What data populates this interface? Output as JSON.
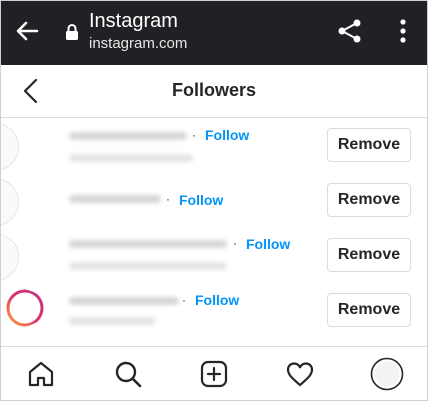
{
  "browser": {
    "site_title": "Instagram",
    "url": "instagram.com"
  },
  "header": {
    "title": "Followers"
  },
  "followers": [
    {
      "follow_label": "Follow",
      "remove_label": "Remove"
    },
    {
      "follow_label": "Follow",
      "remove_label": "Remove"
    },
    {
      "follow_label": "Follow",
      "remove_label": "Remove"
    },
    {
      "follow_label": "Follow",
      "remove_label": "Remove"
    }
  ],
  "colors": {
    "browser_bar": "#202124",
    "follow_link": "#0095f6",
    "text": "#262626",
    "border": "#dbdbdb"
  },
  "icons": {
    "browser_back": "back-arrow-icon",
    "lock": "lock-icon",
    "share": "share-icon",
    "more": "more-vertical-icon",
    "header_back": "chevron-left-icon",
    "nav": [
      "home-icon",
      "search-icon",
      "new-post-icon",
      "activity-heart-icon",
      "profile-avatar-icon"
    ]
  }
}
